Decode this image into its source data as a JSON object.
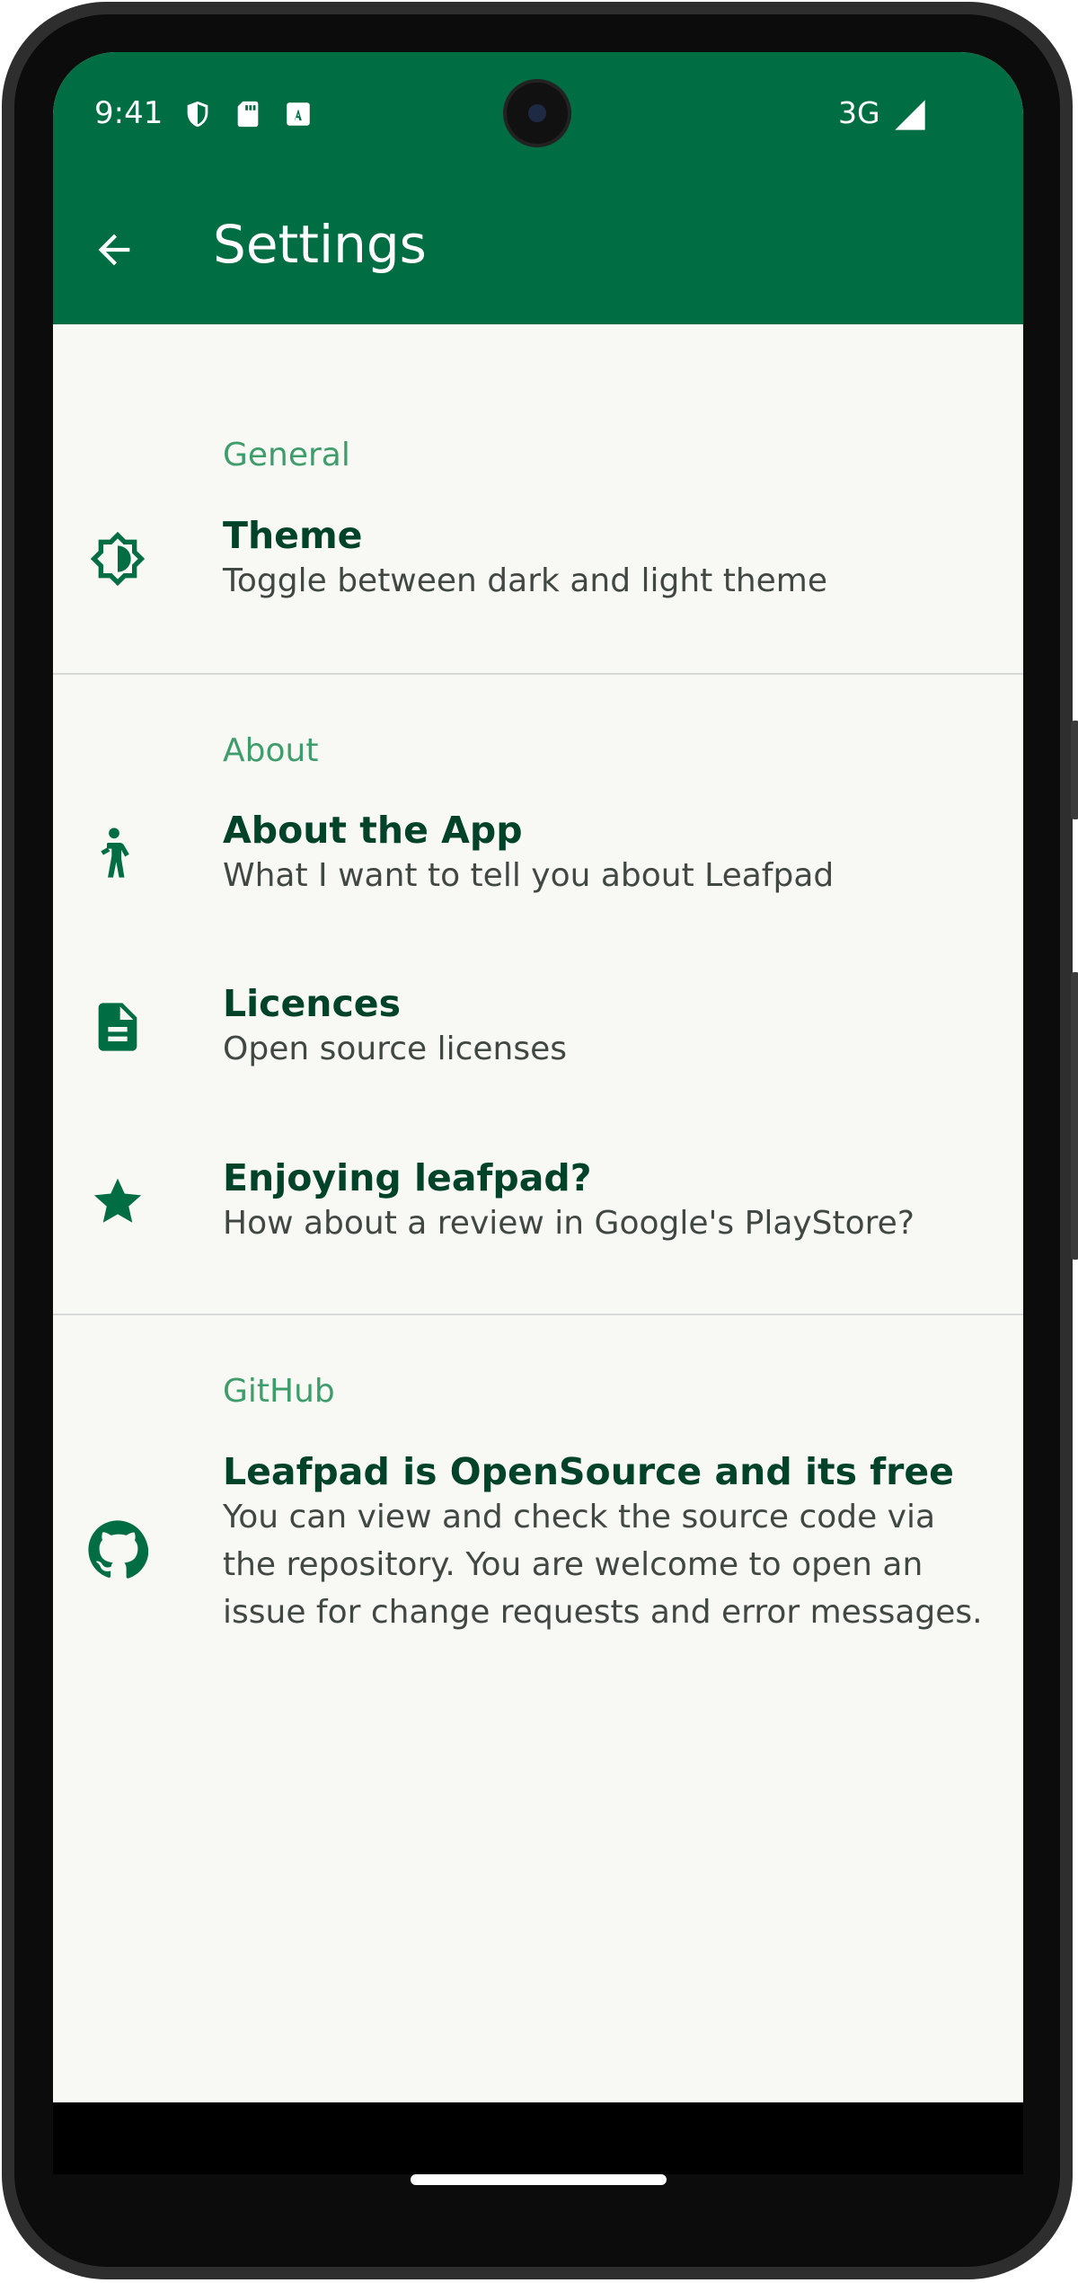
{
  "status_bar": {
    "time": "9:41",
    "network": "3G",
    "icons": [
      "shield-icon",
      "sd-card-icon",
      "keyboard-a-icon",
      "signal-icon"
    ]
  },
  "app_bar": {
    "title": "Settings",
    "back_icon": "arrow-back-icon"
  },
  "sections": [
    {
      "header": "General",
      "items": [
        {
          "title": "Theme",
          "subtitle": "Toggle between dark and light theme",
          "icon": "brightness-icon"
        }
      ]
    },
    {
      "header": "About",
      "items": [
        {
          "title": "About the App",
          "subtitle": "What I want to tell you about Leafpad",
          "icon": "person-icon"
        },
        {
          "title": "Licences",
          "subtitle": "Open source licenses",
          "icon": "document-icon"
        },
        {
          "title": "Enjoying leafpad?",
          "subtitle": "How about a review in Google's PlayStore?",
          "icon": "star-icon"
        }
      ]
    },
    {
      "header": "GitHub",
      "items": [
        {
          "title": "Leafpad is OpenSource and its free",
          "subtitle": "You can view and check the source code via the repository. You are welcome to open an issue for change requests and error messages.",
          "icon": "github-icon"
        }
      ]
    }
  ],
  "colors": {
    "primary": "#006d43",
    "section_header": "#3f9d6c",
    "title": "#00432a",
    "subtitle": "#414844",
    "background": "#f8f9f5"
  }
}
